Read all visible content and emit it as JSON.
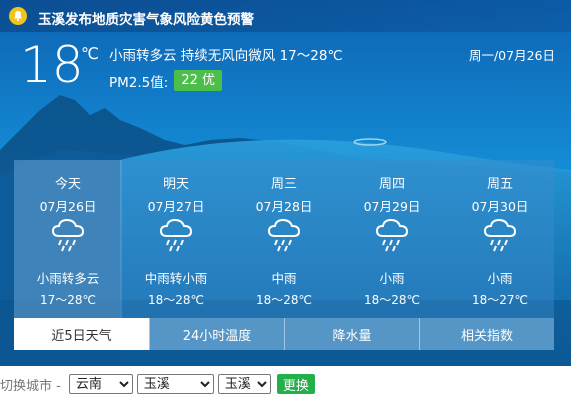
{
  "alert": {
    "text": "玉溪发布地质灾害气象风险黄色预警",
    "icon": "bell-icon"
  },
  "current": {
    "temperature": "18",
    "unit": "℃",
    "condition_line": "小雨转多云   持续无风向微风   17～28℃",
    "pm_label": "PM2.5值:",
    "pm_value": "22 优",
    "date": "周一/07月26日"
  },
  "forecast": [
    {
      "day": "今天",
      "date": "07月26日",
      "condition": "小雨转多云",
      "range": "17～28℃",
      "icon": "light-rain-icon"
    },
    {
      "day": "明天",
      "date": "07月27日",
      "condition": "中雨转小雨",
      "range": "18～28℃",
      "icon": "light-rain-icon"
    },
    {
      "day": "周三",
      "date": "07月28日",
      "condition": "中雨",
      "range": "18～28℃",
      "icon": "light-rain-icon"
    },
    {
      "day": "周四",
      "date": "07月29日",
      "condition": "小雨",
      "range": "18～28℃",
      "icon": "light-rain-icon"
    },
    {
      "day": "周五",
      "date": "07月30日",
      "condition": "小雨",
      "range": "18～27℃",
      "icon": "light-rain-icon"
    }
  ],
  "tabs": [
    {
      "label": "近5日天气",
      "active": true
    },
    {
      "label": "24小时温度",
      "active": false
    },
    {
      "label": "降水量",
      "active": false
    },
    {
      "label": "相关指数",
      "active": false
    }
  ],
  "city_switch": {
    "label": "切换城市 -",
    "province": "云南",
    "city": "玉溪",
    "district": "玉溪",
    "button": "更换"
  },
  "colors": {
    "pm_badge": "#4cbf4b",
    "alert_icon": "#f0c419",
    "switch_button": "#23b04a"
  }
}
